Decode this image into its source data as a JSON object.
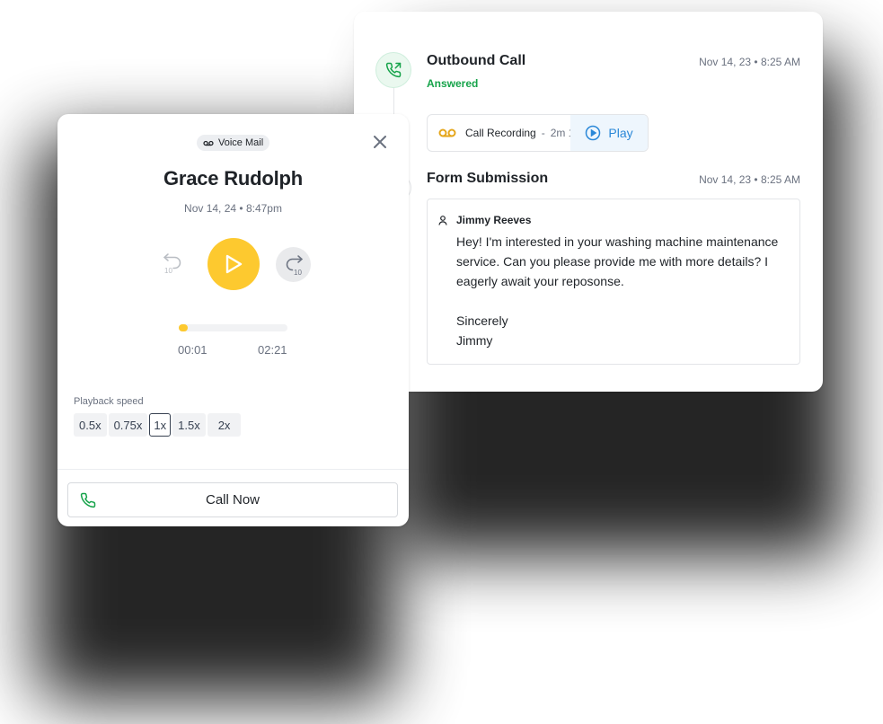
{
  "colors": {
    "accent_yellow": "#fdc92f",
    "success_green": "#16a34a",
    "link_blue": "#2b88d8",
    "recording_icon": "#e5a61b"
  },
  "activity": {
    "outbound": {
      "title": "Outbound Call",
      "date": "Nov 14, 23 • 8:25 AM",
      "status": "Answered",
      "icon": "phone-outgoing-icon",
      "recording": {
        "label": "Call Recording",
        "separator": "-",
        "duration": "2m 1",
        "play_label": "Play"
      }
    },
    "form": {
      "title": "Form Submission",
      "date": "Nov 14, 23 • 8:25 AM",
      "author": "Jimmy Reeves",
      "message": "Hey! I'm interested in your washing machine maintenance service. Can you please provide me with more details? I eagerly await your reposonse.",
      "signoff": "Sincerely",
      "signature": "Jimmy"
    }
  },
  "voicemail": {
    "badge": "Voice Mail",
    "name": "Grace Rudolph",
    "date": "Nov 14, 24 • 8:47pm",
    "rewind_seconds": "10",
    "forward_seconds": "10",
    "progress": 0.08,
    "current_time": "00:01",
    "total_time": "02:21",
    "playback_label": "Playback speed",
    "speeds": [
      "0.5x",
      "0.75x",
      "1x",
      "1.5x",
      "2x"
    ],
    "selected_speed": "1x",
    "call_label": "Call Now"
  }
}
